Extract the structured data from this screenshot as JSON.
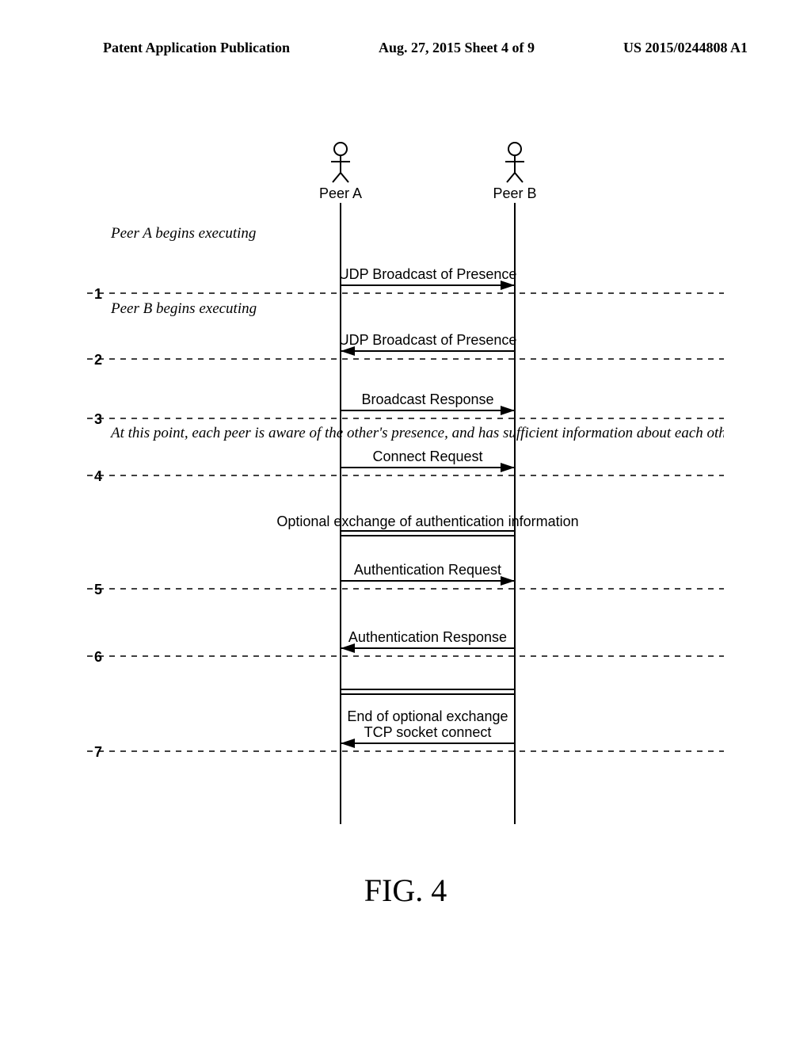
{
  "header": {
    "left": "Patent Application Publication",
    "center": "Aug. 27, 2015  Sheet 4 of 9",
    "right": "US 2015/0244808 A1"
  },
  "sequence": {
    "actors": {
      "a": "Peer A",
      "b": "Peer B"
    },
    "rows": {
      "r0": {
        "note": "Peer A begins executing",
        "msg": "UDP Broadcast of Presence"
      },
      "r1": {
        "num": "1",
        "note": "Peer B begins executing",
        "msg": "UDP Broadcast of Presence"
      },
      "r2": {
        "num": "2",
        "msg": "Broadcast Response"
      },
      "r3": {
        "num": "3",
        "note": "At this point, each peer is aware of the other's presence, and has sufficient information about each other to connect if desired",
        "msg": "Connect Request"
      },
      "r4": {
        "num": "4",
        "msg": "Optional exchange of authentication information"
      },
      "r5": {
        "num": "5",
        "msg": "Authentication Request"
      },
      "r6": {
        "num": "6",
        "msg": "Authentication Response"
      },
      "r7": {
        "num": "7",
        "msg1": "End of optional exchange",
        "msg2": "TCP socket connect"
      }
    }
  },
  "figure_label": "FIG. 4"
}
